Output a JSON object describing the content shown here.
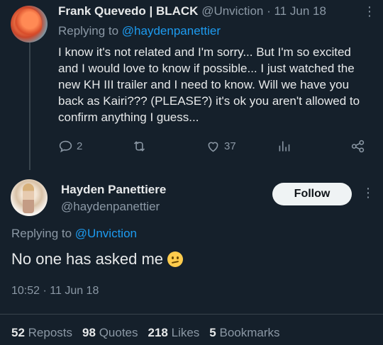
{
  "reply_tweet": {
    "display_name": "Frank Quevedo | BLACK",
    "handle": "@Unviction",
    "date": "· 11 Jun 18",
    "replying_to_label": "Replying to",
    "replying_to_handle": "@haydenpanettier",
    "body": "I know it's not related and I'm sorry... But I'm so excited and I would love to know if possible... I just watched the new KH III trailer and I need to know. Will we have you back as Kairi??? (PLEASE?) it's ok you aren't allowed to confirm anything I guess...",
    "actions": {
      "reply_count": "2",
      "like_count": "37"
    }
  },
  "main_tweet": {
    "display_name": "Hayden Panettiere",
    "handle": "@haydenpanettier",
    "follow_label": "Follow",
    "replying_to_label": "Replying to",
    "replying_to_handle": "@Unviction",
    "body": "No one has asked me",
    "timestamp": "10:52 · 11 Jun 18",
    "stats": {
      "reposts_count": "52",
      "reposts_label": "Reposts",
      "quotes_count": "98",
      "quotes_label": "Quotes",
      "likes_count": "218",
      "likes_label": "Likes",
      "bookmarks_count": "5",
      "bookmarks_label": "Bookmarks"
    }
  },
  "icons": [
    "more-icon",
    "reply-icon",
    "retweet-icon",
    "like-icon",
    "views-icon",
    "share-icon",
    "confused-face-emoji"
  ],
  "colors": {
    "background": "#15202b",
    "text": "#e7e9ea",
    "muted": "#8b98a5",
    "link": "#1d9bf0"
  }
}
